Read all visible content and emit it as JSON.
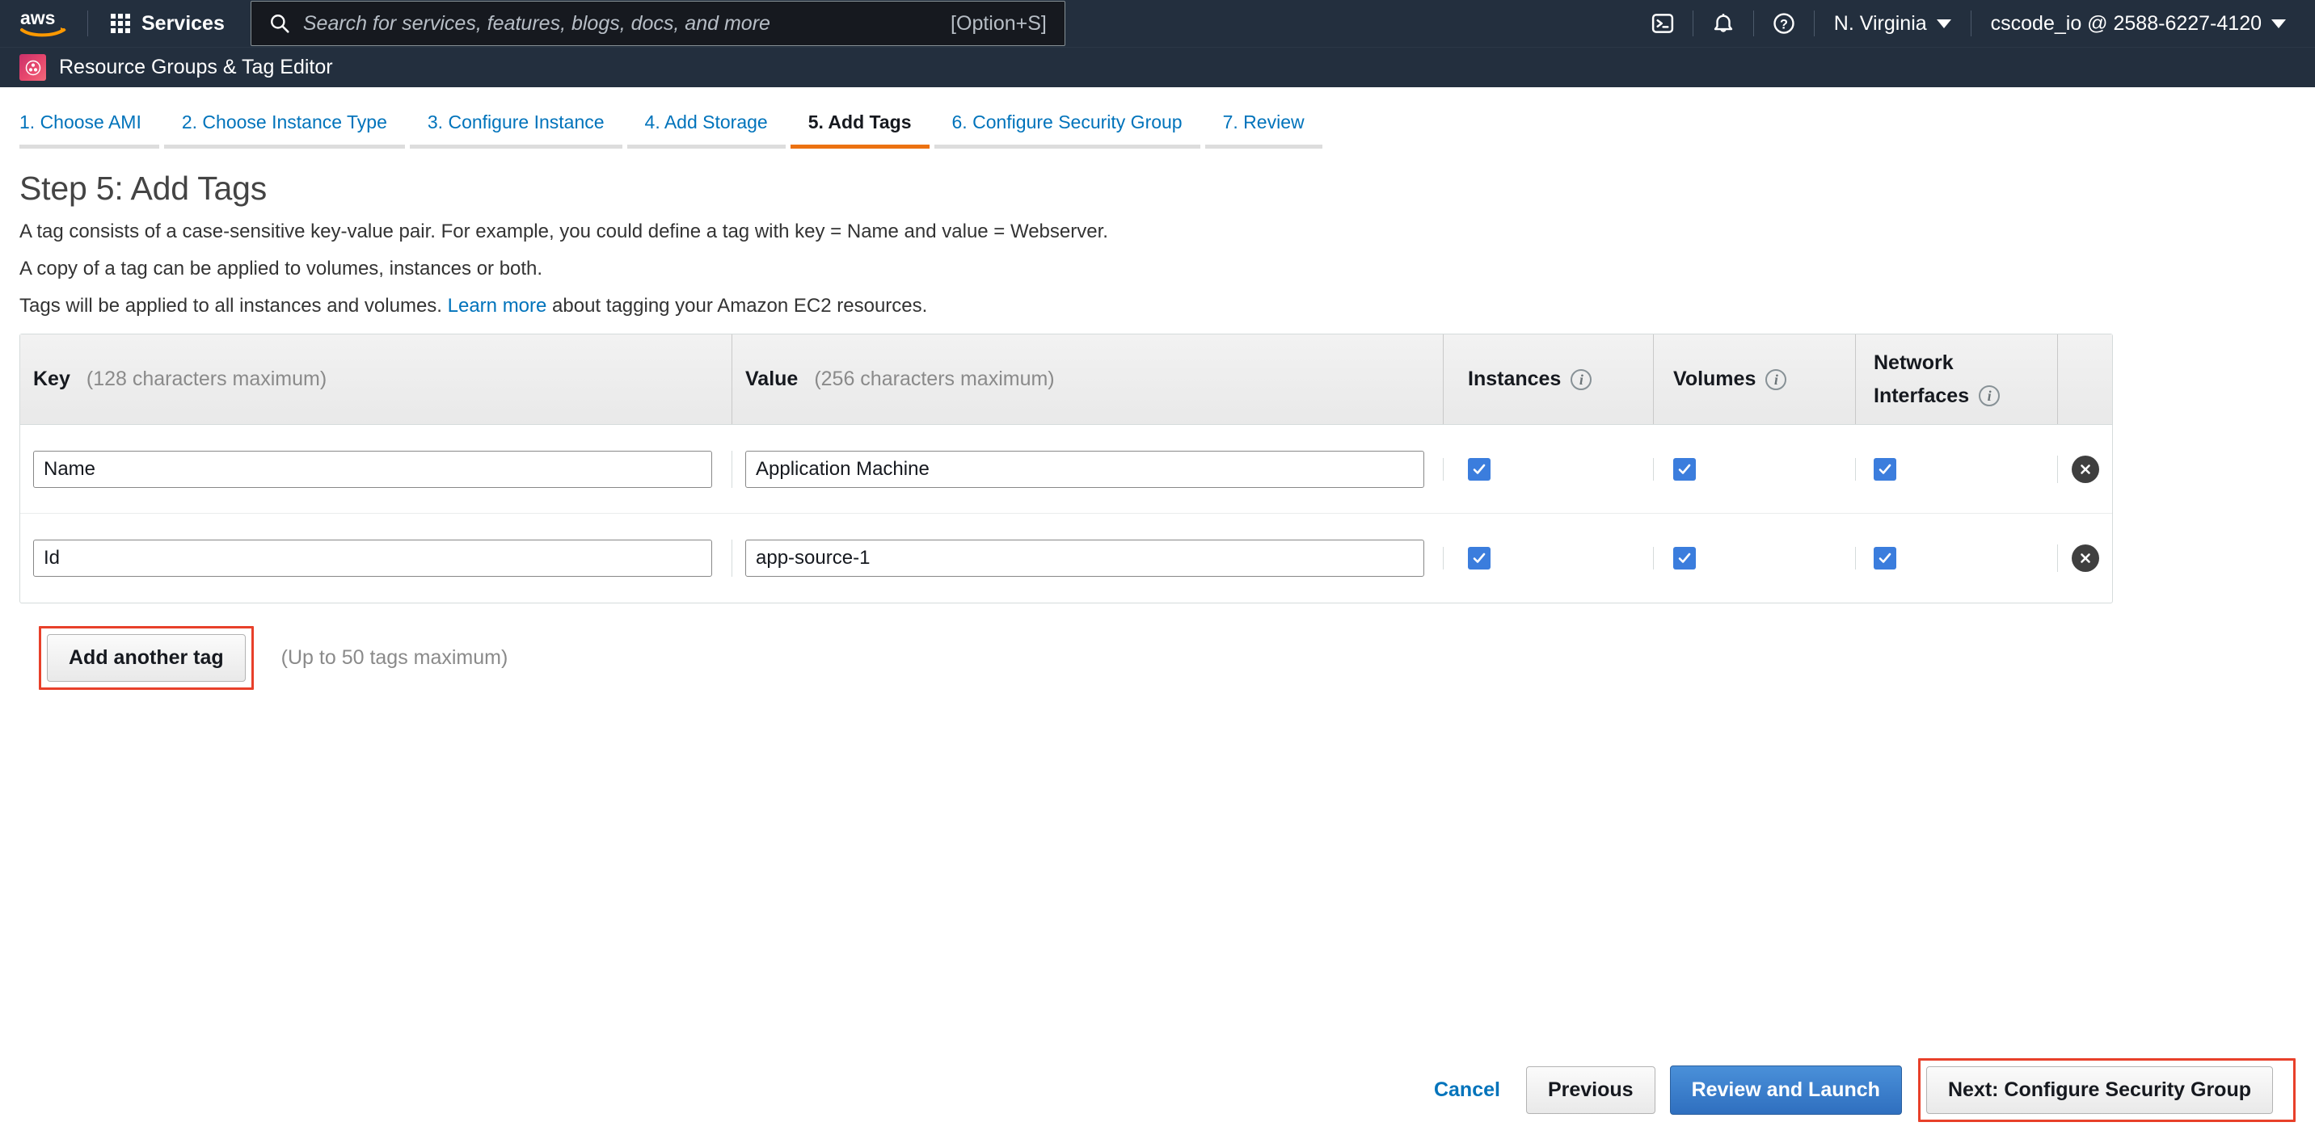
{
  "topnav": {
    "logo_alt": "aws",
    "services_label": "Services",
    "search": {
      "placeholder": "Search for services, features, blogs, docs, and more",
      "value": "",
      "shortcut": "[Option+S]"
    },
    "icons": {
      "cloudshell": "cloudshell-icon",
      "notifications": "bell-icon",
      "help": "help-icon"
    },
    "region": "N. Virginia",
    "account": "cscode_io @ 2588-6227-4120"
  },
  "subnav": {
    "icon": "resource-groups-icon",
    "label": "Resource Groups & Tag Editor"
  },
  "wizard": {
    "steps": [
      {
        "label": "1. Choose AMI",
        "active": false
      },
      {
        "label": "2. Choose Instance Type",
        "active": false
      },
      {
        "label": "3. Configure Instance",
        "active": false
      },
      {
        "label": "4. Add Storage",
        "active": false
      },
      {
        "label": "5. Add Tags",
        "active": true
      },
      {
        "label": "6. Configure Security Group",
        "active": false
      },
      {
        "label": "7. Review",
        "active": false
      }
    ]
  },
  "page": {
    "title": "Step 5: Add Tags",
    "desc_line1": "A tag consists of a case-sensitive key-value pair. For example, you could define a tag with key = Name and value = Webserver.",
    "desc_line2": "A copy of a tag can be applied to volumes, instances or both.",
    "desc_line3_pre": "Tags will be applied to all instances and volumes. ",
    "desc_link": "Learn more",
    "desc_line3_post": " about tagging your Amazon EC2 resources."
  },
  "table": {
    "headers": {
      "key": "Key",
      "key_hint": "(128 characters maximum)",
      "value": "Value",
      "value_hint": "(256 characters maximum)",
      "instances": "Instances",
      "volumes": "Volumes",
      "network_line1": "Network",
      "network_line2": "Interfaces"
    },
    "rows": [
      {
        "key": "Name",
        "value": "Application Machine",
        "instances_checked": true,
        "volumes_checked": true,
        "network_checked": true,
        "delete_label": "Remove tag"
      },
      {
        "key": "Id",
        "value": "app-source-1",
        "instances_checked": true,
        "volumes_checked": true,
        "network_checked": true,
        "delete_label": "Remove tag"
      }
    ]
  },
  "add_tag": {
    "button_label": "Add another tag",
    "hint": "(Up to 50 tags maximum)",
    "highlighted": true
  },
  "footer": {
    "cancel": "Cancel",
    "previous": "Previous",
    "review_and_launch": "Review and Launch",
    "next": "Next: Configure Security Group",
    "next_highlighted": true
  },
  "colors": {
    "nav_bg": "#232f3e",
    "accent_orange": "#ec7211",
    "link_blue": "#0073bb",
    "primary_blue": "#3277bf",
    "checkbox_blue": "#3b7ddd",
    "highlight_red": "#e8402a",
    "resource_group_pink": "#e8486d"
  }
}
